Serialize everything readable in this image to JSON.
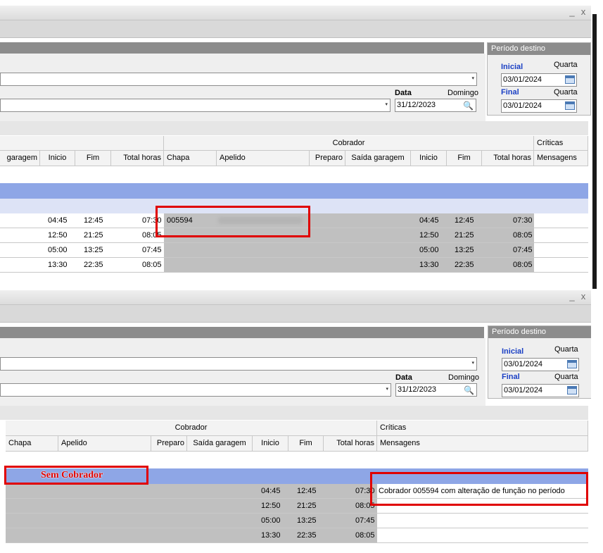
{
  "window": {
    "minimize_glyph": "_",
    "close_glyph": "x"
  },
  "form": {
    "data_label": "Data",
    "data_day": "Domingo",
    "data_value": "31/12/2023",
    "combo_arrow": "▾"
  },
  "periodo": {
    "title": "Período destino",
    "inicial_label": "Inicial",
    "inicial_day": "Quarta",
    "inicial_value": "03/01/2024",
    "final_label": "Final",
    "final_day": "Quarta",
    "final_value": "03/01/2024"
  },
  "top_grid": {
    "group_cobrador": "Cobrador",
    "group_criticas": "Críticas",
    "columns": [
      "garagem",
      "Inicio",
      "Fim",
      "Total horas",
      "Chapa",
      "Apelido",
      "Preparo",
      "Saída garagem",
      "Inicio",
      "Fim",
      "Total horas",
      "Mensagens"
    ],
    "rows": [
      {
        "inicio": "04:45",
        "fim": "12:45",
        "total": "07:30",
        "chapa": "005594",
        "c_inicio": "04:45",
        "c_fim": "12:45",
        "c_total": "07:30"
      },
      {
        "inicio": "12:50",
        "fim": "21:25",
        "total": "08:05",
        "chapa": "",
        "c_inicio": "12:50",
        "c_fim": "21:25",
        "c_total": "08:05"
      },
      {
        "inicio": "05:00",
        "fim": "13:25",
        "total": "07:45",
        "chapa": "",
        "c_inicio": "05:00",
        "c_fim": "13:25",
        "c_total": "07:45"
      },
      {
        "inicio": "13:30",
        "fim": "22:35",
        "total": "08:05",
        "chapa": "",
        "c_inicio": "13:30",
        "c_fim": "22:35",
        "c_total": "08:05"
      }
    ]
  },
  "bottom_grid": {
    "group_cobrador": "Cobrador",
    "group_criticas": "Críticas",
    "columns": [
      "Chapa",
      "Apelido",
      "Preparo",
      "Saída garagem",
      "Inicio",
      "Fim",
      "Total horas",
      "Mensagens"
    ],
    "annotation": "Sem Cobrador",
    "rows": [
      {
        "inicio": "04:45",
        "fim": "12:45",
        "total": "07:30",
        "mensagem": "Cobrador 005594 com alteração de função no período"
      },
      {
        "inicio": "12:50",
        "fim": "21:25",
        "total": "08:05",
        "mensagem": ""
      },
      {
        "inicio": "05:00",
        "fim": "13:25",
        "total": "07:45",
        "mensagem": ""
      },
      {
        "inicio": "13:30",
        "fim": "22:35",
        "total": "08:05",
        "mensagem": ""
      }
    ]
  },
  "colors": {
    "accent_blue": "#1a3fc4",
    "selected_row": "#8ea6e6",
    "highlight": "#e00000",
    "annotation_text": "#e00000"
  }
}
